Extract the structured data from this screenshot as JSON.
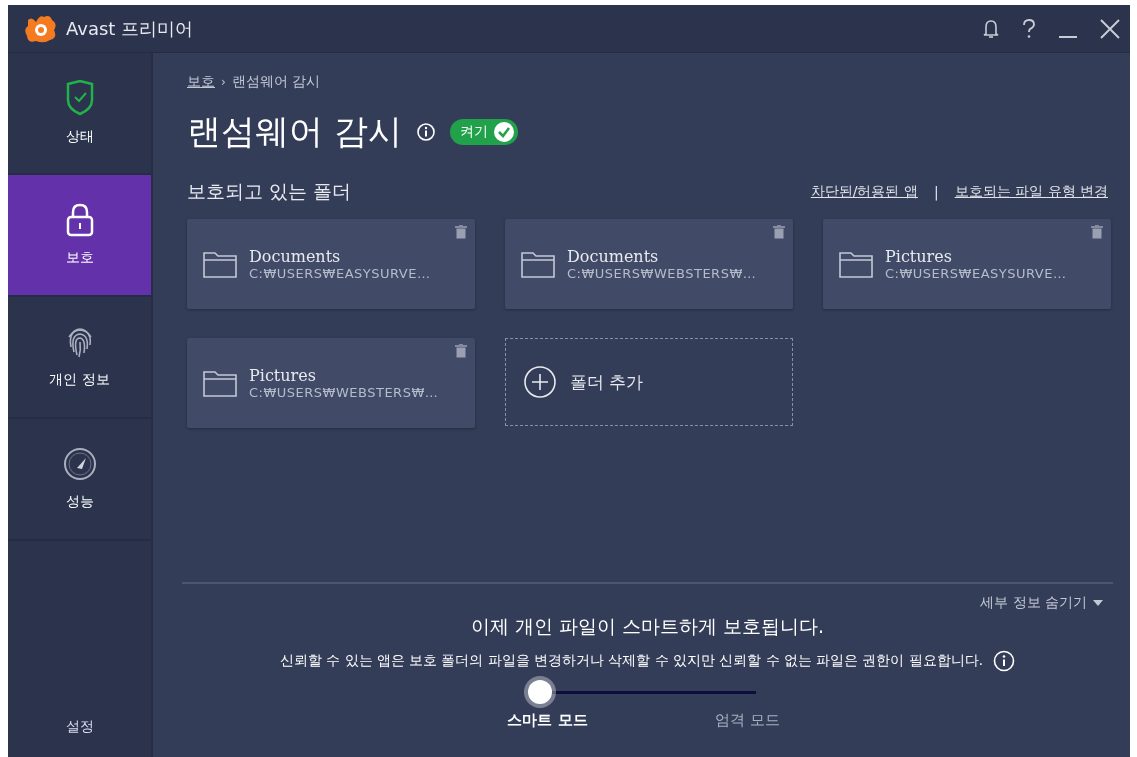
{
  "window": {
    "title": "Avast 프리미어"
  },
  "sidebar": {
    "items": [
      {
        "label": "상태",
        "selected": false
      },
      {
        "label": "보호",
        "selected": true
      },
      {
        "label": "개인 정보",
        "selected": false
      },
      {
        "label": "성능",
        "selected": false
      }
    ],
    "settings": "설정"
  },
  "breadcrumb": {
    "parent": "보호",
    "separator": "›",
    "current": "랜섬웨어 감시"
  },
  "heading": {
    "title": "랜섬웨어 감시",
    "switch": {
      "label": "켜기",
      "on": true
    }
  },
  "folders": {
    "title": "보호되고 있는 폴더",
    "links": [
      "차단된/허용된 앱",
      "보호되는 파일 유형 변경"
    ],
    "separator": "|",
    "items": [
      {
        "name": "Documents",
        "path": "C:₩USERS₩EASYSURVE…"
      },
      {
        "name": "Documents",
        "path": "C:₩USERS₩WEBSTERS₩…"
      },
      {
        "name": "Pictures",
        "path": "C:₩USERS₩EASYSURVE…"
      },
      {
        "name": "Pictures",
        "path": "C:₩USERS₩WEBSTERS₩…"
      }
    ],
    "add": "폴더 추가"
  },
  "details": {
    "toggle": "세부 정보 숨기기",
    "headline": "이제 개인 파일이 스마트하게 보호됩니다.",
    "description": "신뢰할 수 있는 앱은 보호 폴더의 파일을 변경하거나 삭제할 수 있지만 신뢰할 수 없는 파일은 권한이 필요합니다.",
    "slider": {
      "level": 0
    },
    "modes": [
      {
        "label": "스마트 모드",
        "selected": true
      },
      {
        "label": "엄격 모드",
        "selected": false
      }
    ]
  }
}
